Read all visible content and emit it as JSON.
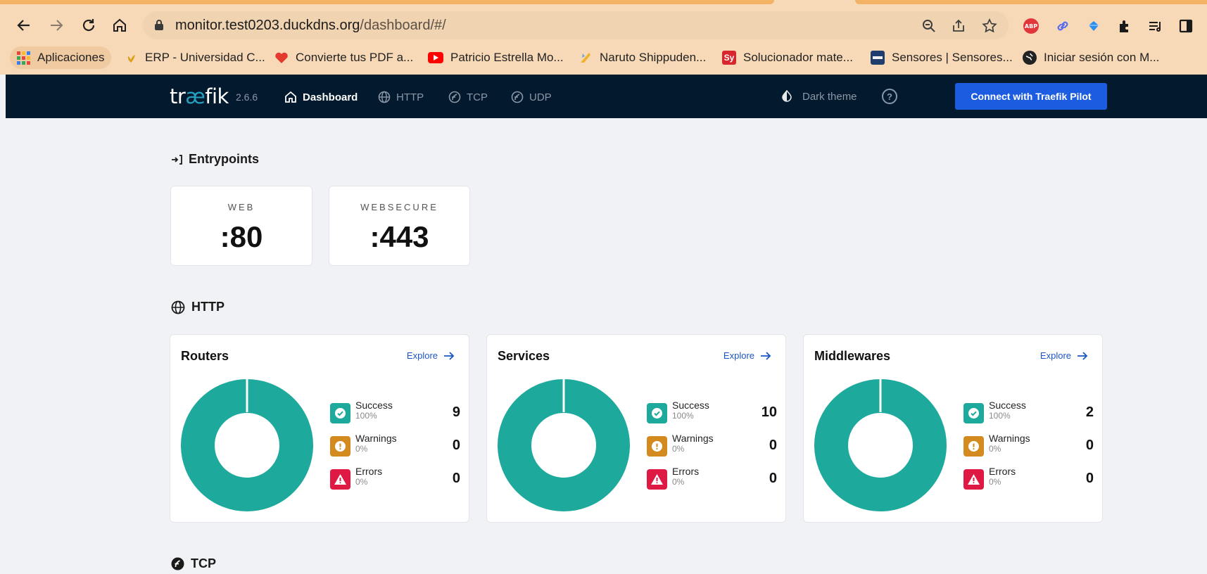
{
  "browser": {
    "url_host": "monitor.test0203.duckdns.org",
    "url_path": "/dashboard/#/",
    "bookmarks": [
      {
        "label": "Aplicaciones",
        "icon": "apps-grid-icon"
      },
      {
        "label": "ERP - Universidad C...",
        "icon": "erp-favicon-icon"
      },
      {
        "label": "Convierte tus PDF a...",
        "icon": "heart-favicon-icon"
      },
      {
        "label": "Patricio Estrella Mo...",
        "icon": "youtube-icon"
      },
      {
        "label": "Naruto Shippuden...",
        "icon": "naruto-favicon-icon"
      },
      {
        "label": "Solucionador mate...",
        "icon": "symbolab-icon",
        "icon_text": "Sy"
      },
      {
        "label": "Sensores | Sensores...",
        "icon": "sensores-favicon-icon"
      },
      {
        "label": "Iniciar sesión con M...",
        "icon": "globe-favicon-icon"
      }
    ],
    "accent": "#f3b265"
  },
  "traefik": {
    "logo_left": "tr",
    "logo_ae": "æ",
    "logo_right": "fik",
    "version": "2.6.6",
    "nav": [
      {
        "label": "Dashboard",
        "icon": "home-icon",
        "active": true
      },
      {
        "label": "HTTP",
        "icon": "globe-icon",
        "active": false
      },
      {
        "label": "TCP",
        "icon": "tcp-icon",
        "active": false
      },
      {
        "label": "UDP",
        "icon": "udp-icon",
        "active": false
      }
    ],
    "dark_theme_label": "Dark theme",
    "help_label": "?",
    "pilot_button": "Connect with Traefik Pilot",
    "header_color": "#03192d"
  },
  "entrypoints": {
    "title": "Entrypoints",
    "items": [
      {
        "name": "WEB",
        "port": ":80"
      },
      {
        "name": "WEBSECURE",
        "port": ":443"
      }
    ]
  },
  "http": {
    "title": "HTTP",
    "explore_label": "Explore",
    "cards": [
      {
        "title": "Routers",
        "success": {
          "label": "Success",
          "pct": "100%",
          "count": "9"
        },
        "warnings": {
          "label": "Warnings",
          "pct": "0%",
          "count": "0"
        },
        "errors": {
          "label": "Errors",
          "pct": "0%",
          "count": "0"
        }
      },
      {
        "title": "Services",
        "success": {
          "label": "Success",
          "pct": "100%",
          "count": "10"
        },
        "warnings": {
          "label": "Warnings",
          "pct": "0%",
          "count": "0"
        },
        "errors": {
          "label": "Errors",
          "pct": "0%",
          "count": "0"
        }
      },
      {
        "title": "Middlewares",
        "success": {
          "label": "Success",
          "pct": "100%",
          "count": "2"
        },
        "warnings": {
          "label": "Warnings",
          "pct": "0%",
          "count": "0"
        },
        "errors": {
          "label": "Errors",
          "pct": "0%",
          "count": "0"
        }
      }
    ],
    "colors": {
      "success": "#1da99b",
      "warning": "#d38a1e",
      "error": "#dd1944"
    }
  },
  "tcp": {
    "title": "TCP"
  }
}
